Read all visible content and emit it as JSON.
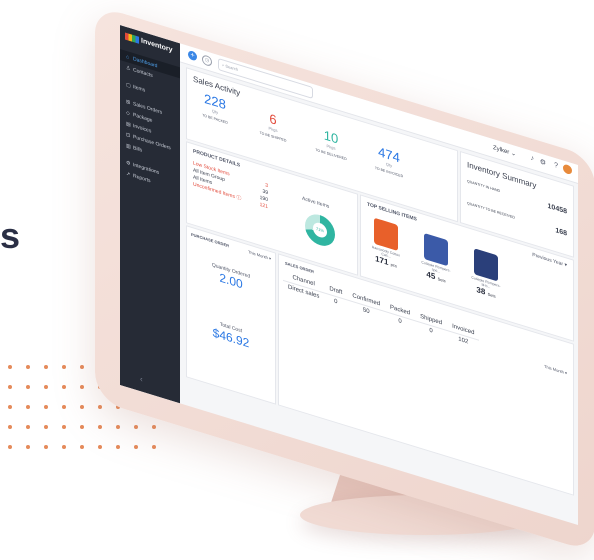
{
  "side_text": "s",
  "colors": {
    "sidebar": "#262b36",
    "accent": "#2b78e4",
    "teal": "#2fb5a1",
    "red": "#e24a3b",
    "monitor": "#f6e4de",
    "dots": "#e58a5a"
  },
  "app": {
    "logo_text": "Inventory",
    "search_placeholder": "Search",
    "org_name": "Zylker",
    "plus_label": "+"
  },
  "nav": [
    {
      "label": "Dashboard",
      "icon": "home-icon"
    },
    {
      "label": "Contacts",
      "icon": "contacts-icon"
    },
    {
      "label": "Items",
      "icon": "items-icon"
    },
    {
      "label": "Sales Orders",
      "icon": "cart-icon"
    },
    {
      "label": "Package",
      "icon": "package-icon"
    },
    {
      "label": "Invoices",
      "icon": "invoice-icon"
    },
    {
      "label": "Purchase Orders",
      "icon": "purchase-icon"
    },
    {
      "label": "Bills",
      "icon": "bill-icon"
    },
    {
      "label": "Integrations",
      "icon": "integration-icon"
    },
    {
      "label": "Reports",
      "icon": "reports-icon"
    }
  ],
  "sales_activity": {
    "title": "Sales Activity",
    "stats": [
      {
        "value": "228",
        "unit": "Qty",
        "label": "TO BE PACKED",
        "color": "#2b78e4"
      },
      {
        "value": "6",
        "unit": "Pkgs",
        "label": "TO BE SHIPPED",
        "color": "#e24a3b"
      },
      {
        "value": "10",
        "unit": "Pkgs",
        "label": "TO BE DELIVERED",
        "color": "#2fb5a1"
      },
      {
        "value": "474",
        "unit": "Qty",
        "label": "TO BE INVOICED",
        "color": "#2b78e4"
      }
    ]
  },
  "inventory_summary": {
    "title": "Inventory Summary",
    "in_hand_label": "QUANTITY IN HAND",
    "in_hand_value": "10458",
    "to_receive_label": "QUANTITY TO BE RECEIVED",
    "to_receive_value": "168"
  },
  "product_details": {
    "title": "PRODUCT DETAILS",
    "rows": [
      {
        "label": "Low Stock Items",
        "value": "3",
        "alert": true
      },
      {
        "label": "All Item Group",
        "value": "39",
        "alert": false
      },
      {
        "label": "All Items",
        "value": "190",
        "alert": false
      },
      {
        "label": "Unconfirmed Items ⓘ",
        "value": "121",
        "alert": true
      }
    ],
    "active_items_label": "Active Items",
    "active_percent": "71%"
  },
  "top_selling": {
    "title": "TOP SELLING ITEMS",
    "period": "Previous Year ▾",
    "items": [
      {
        "name": "Hanswooly Cotton Cas...",
        "qty": "171",
        "unit": "pcs",
        "color": "#e8602a"
      },
      {
        "name": "Cutiepie Rompers-spo...",
        "qty": "45",
        "unit": "Sets",
        "color": "#3b5aa8"
      },
      {
        "name": "Cutiepie Rompers-bl-b...",
        "qty": "38",
        "unit": "Sets",
        "color": "#2a3f7a"
      }
    ]
  },
  "purchase_order": {
    "title": "PURCHASE ORDER",
    "period": "This Month ▾",
    "qty_label": "Quantity Ordered",
    "qty_value": "2.00",
    "cost_label": "Total Cost",
    "cost_value": "$46.92"
  },
  "sales_order": {
    "title": "SALES ORDER",
    "period": "This Month ▾",
    "headers": [
      "Channel",
      "Draft",
      "Confirmed",
      "Packed",
      "Shipped",
      "Invoiced"
    ],
    "rows": [
      {
        "channel": "Direct sales",
        "draft": "0",
        "confirmed": "50",
        "packed": "0",
        "shipped": "0",
        "invoiced": "102"
      }
    ]
  }
}
